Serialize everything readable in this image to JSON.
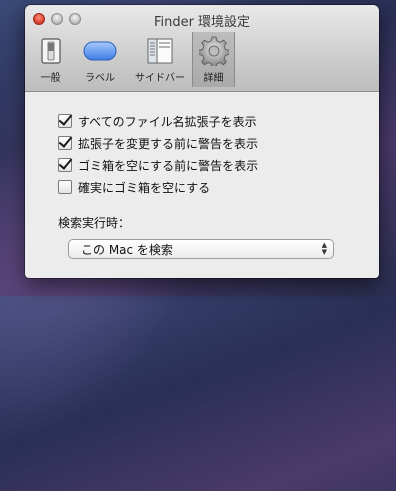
{
  "window": {
    "title": "Finder 環境設定"
  },
  "toolbar": {
    "items": [
      {
        "label": "一般",
        "icon": "switch-icon"
      },
      {
        "label": "ラベル",
        "icon": "label-pill-icon"
      },
      {
        "label": "サイドバー",
        "icon": "sidebar-icon"
      },
      {
        "label": "詳細",
        "icon": "gear-icon",
        "selected": true
      }
    ]
  },
  "options": [
    {
      "label": "すべてのファイル名拡張子を表示",
      "checked": true
    },
    {
      "label": "拡張子を変更する前に警告を表示",
      "checked": true
    },
    {
      "label": "ゴミ箱を空にする前に警告を表示",
      "checked": true
    },
    {
      "label": "確実にゴミ箱を空にする",
      "checked": false
    }
  ],
  "search": {
    "label": "検索実行時：",
    "selected": "この Mac を検索"
  }
}
